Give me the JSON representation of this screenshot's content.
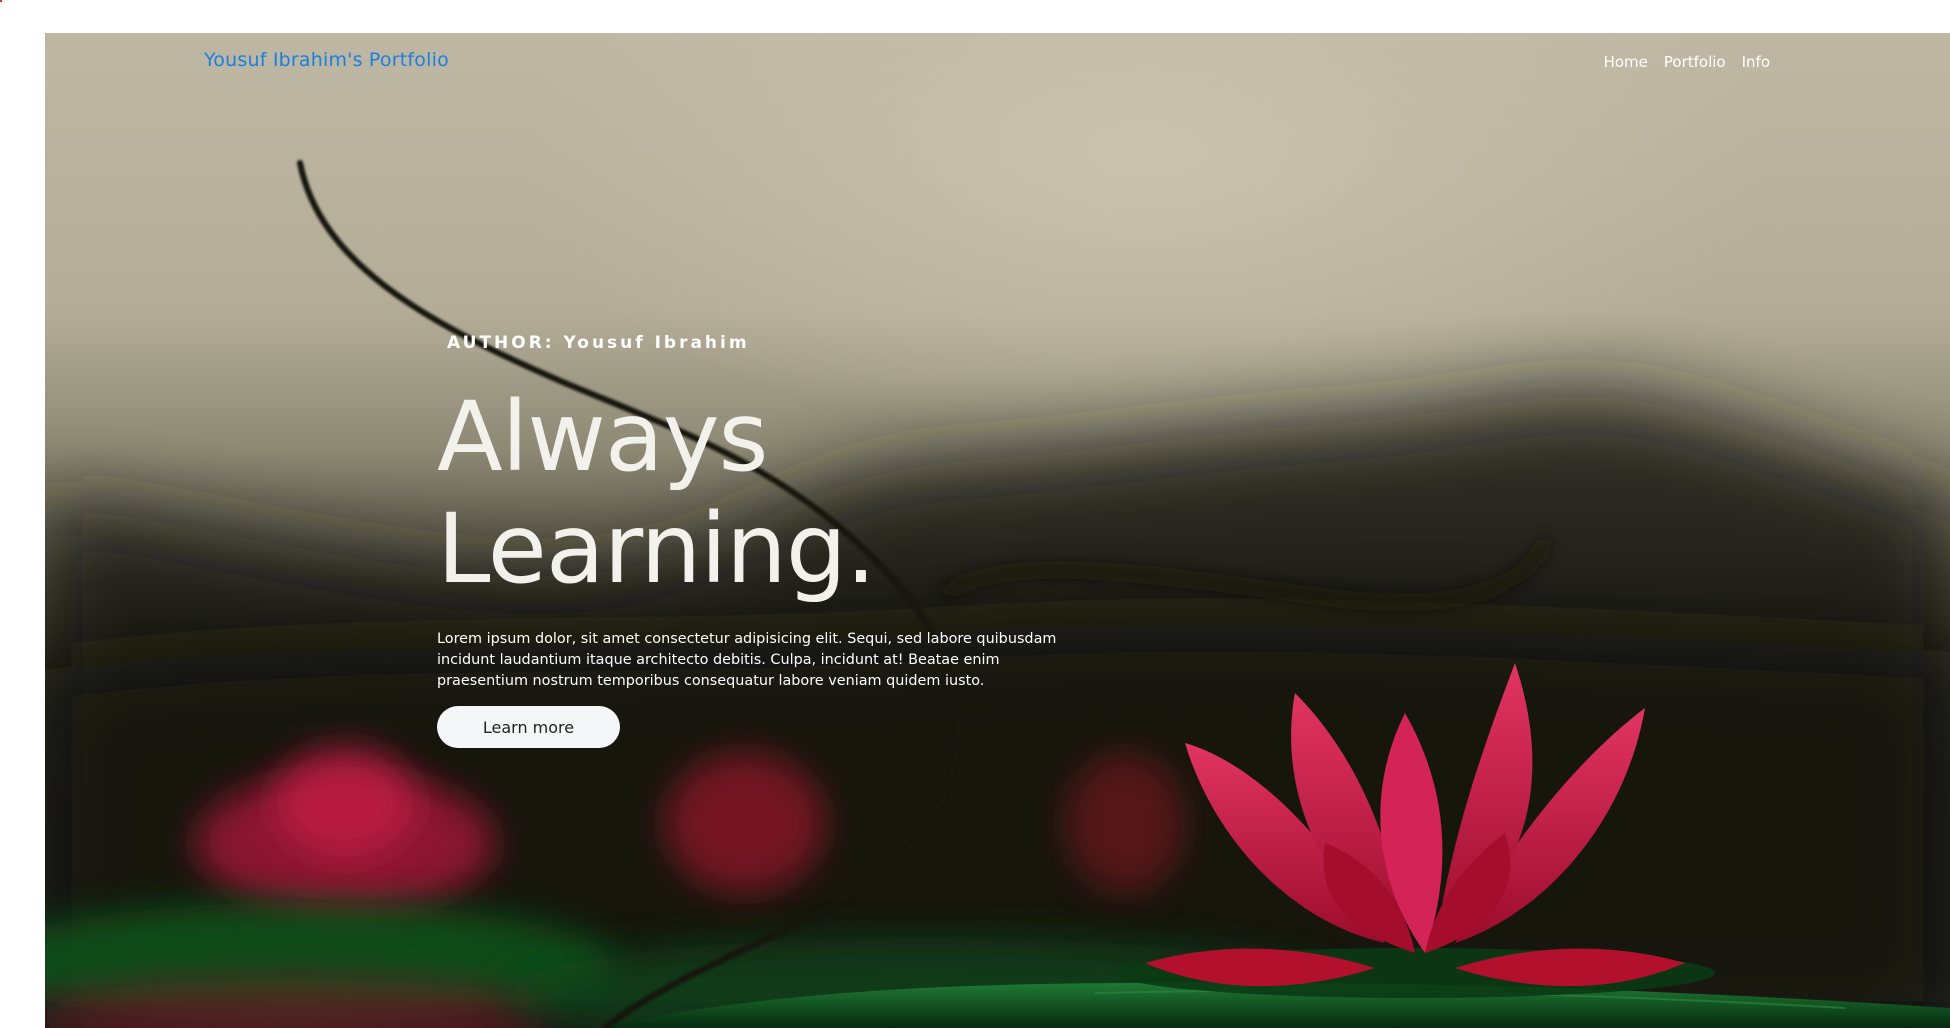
{
  "header": {
    "brand": "Yousuf Ibrahim's Portfolio",
    "nav": [
      "Home",
      "Portfolio",
      "Info"
    ]
  },
  "hero": {
    "author": "AUTHOR: Yousuf Ibrahim",
    "headline_line1": "Always",
    "headline_line2": "Learning.",
    "description": "Lorem ipsum dolor, sit amet consectetur adipisicing elit. Sequi, sed labore quibusdam incidunt laudantium itaque architecto debitis. Culpa, incidunt at! Beatae enim praesentium nostrum temporibus consequatur labore veniam quidem iusto.",
    "cta_label": "Learn more"
  },
  "colors": {
    "brand": "#1b7fe0",
    "text_light": "#ffffff",
    "button_bg": "#f5f6f8",
    "lotus": "#c8143c",
    "leaf": "#0f5a22"
  }
}
